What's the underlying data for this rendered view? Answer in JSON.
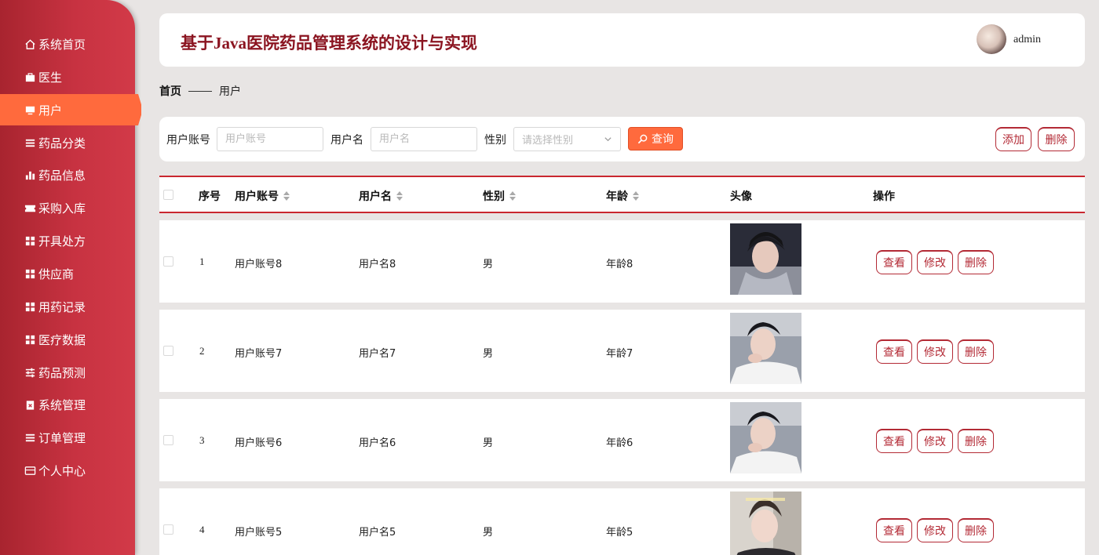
{
  "sidebar": {
    "items": [
      {
        "label": "系统首页",
        "icon": "home-icon"
      },
      {
        "label": "医生",
        "icon": "briefcase-icon"
      },
      {
        "label": "用户",
        "icon": "monitor-icon",
        "active": true
      },
      {
        "label": "药品分类",
        "icon": "list-icon"
      },
      {
        "label": "药品信息",
        "icon": "bar-chart-icon"
      },
      {
        "label": "采购入库",
        "icon": "ticket-icon"
      },
      {
        "label": "开具处方",
        "icon": "grid-icon"
      },
      {
        "label": "供应商",
        "icon": "grid-icon"
      },
      {
        "label": "用药记录",
        "icon": "grid-icon"
      },
      {
        "label": "医疗数据",
        "icon": "grid-icon"
      },
      {
        "label": "药品预测",
        "icon": "sliders-icon"
      },
      {
        "label": "系统管理",
        "icon": "clipboard-x-icon"
      },
      {
        "label": "订单管理",
        "icon": "list-icon"
      },
      {
        "label": "个人中心",
        "icon": "id-card-icon"
      }
    ]
  },
  "header": {
    "title": "基于Java医院药品管理系统的设计与实现",
    "username": "admin"
  },
  "breadcrumb": {
    "home": "首页",
    "current": "用户"
  },
  "search": {
    "account_label": "用户账号",
    "account_placeholder": "用户账号",
    "name_label": "用户名",
    "name_placeholder": "用户名",
    "gender_label": "性别",
    "gender_placeholder": "请选择性别",
    "query_label": "查询",
    "add_label": "添加",
    "delete_label": "删除"
  },
  "table": {
    "columns": {
      "index": "序号",
      "account": "用户账号",
      "name": "用户名",
      "gender": "性别",
      "age": "年龄",
      "avatar": "头像",
      "actions": "操作"
    },
    "actions": {
      "view": "查看",
      "edit": "修改",
      "delete": "删除"
    },
    "rows": [
      {
        "index": "1",
        "account": "用户账号8",
        "name": "用户名8",
        "gender": "男",
        "age": "年龄8"
      },
      {
        "index": "2",
        "account": "用户账号7",
        "name": "用户名7",
        "gender": "男",
        "age": "年龄7"
      },
      {
        "index": "3",
        "account": "用户账号6",
        "name": "用户名6",
        "gender": "男",
        "age": "年龄6"
      },
      {
        "index": "4",
        "account": "用户账号5",
        "name": "用户名5",
        "gender": "男",
        "age": "年龄5"
      }
    ]
  },
  "colors": {
    "sidebar": "#c73241",
    "active": "#ff6a3d",
    "title": "#8b1420",
    "accent_border": "#c9272f"
  }
}
